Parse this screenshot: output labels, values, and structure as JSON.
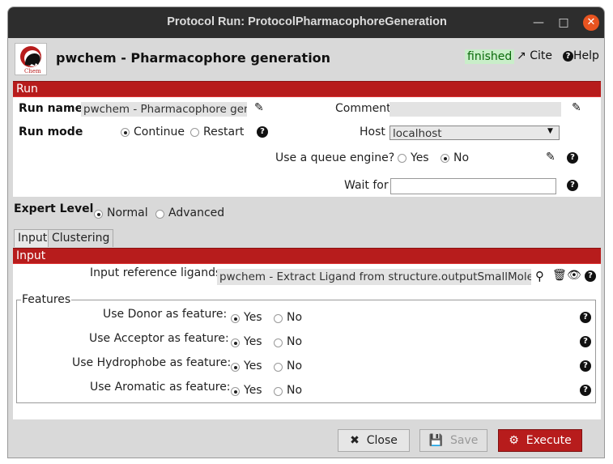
{
  "window": {
    "title": "Protocol Run: ProtocolPharmacophoreGeneration"
  },
  "header": {
    "protocol_title": "pwchem - Pharmacophore generation",
    "status": "finished",
    "cite_label": "Cite",
    "help_label": "Help",
    "logo_text": "Chem"
  },
  "run": {
    "section_label": "Run",
    "run_name_label": "Run name",
    "run_name_value": "pwchem - Pharmacophore gene",
    "comment_label": "Comment",
    "comment_value": "",
    "run_mode_label": "Run mode",
    "continue_label": "Continue",
    "restart_label": "Restart",
    "run_mode_selected": "Continue",
    "host_label": "Host",
    "host_value": "localhost",
    "queue_label": "Use a queue engine?",
    "queue_yes": "Yes",
    "queue_no": "No",
    "queue_selected": "No",
    "wait_for_label": "Wait for",
    "wait_for_value": ""
  },
  "expert": {
    "label": "Expert Level",
    "normal_label": "Normal",
    "advanced_label": "Advanced",
    "selected": "Normal"
  },
  "tabs": [
    {
      "label": "Input",
      "active": true
    },
    {
      "label": "Clustering",
      "active": false
    }
  ],
  "input": {
    "section_label": "Input",
    "ref_ligands_label": "Input reference ligands:",
    "ref_ligands_value": "pwchem - Extract Ligand from structure.outputSmallMolecules",
    "features_legend": "Features",
    "yes_label": "Yes",
    "no_label": "No",
    "features": [
      {
        "label": "Use Donor as feature:",
        "selected": "Yes"
      },
      {
        "label": "Use Acceptor as feature:",
        "selected": "Yes"
      },
      {
        "label": "Use Hydrophobe as feature:",
        "selected": "Yes"
      },
      {
        "label": "Use Aromatic as feature:",
        "selected": "Yes"
      }
    ]
  },
  "footer": {
    "close_label": "Close",
    "save_label": "Save",
    "execute_label": "Execute"
  },
  "colors": {
    "accent": "#b71c1c",
    "status_bg": "#c9eec9",
    "titlebar": "#2d2d2d"
  }
}
